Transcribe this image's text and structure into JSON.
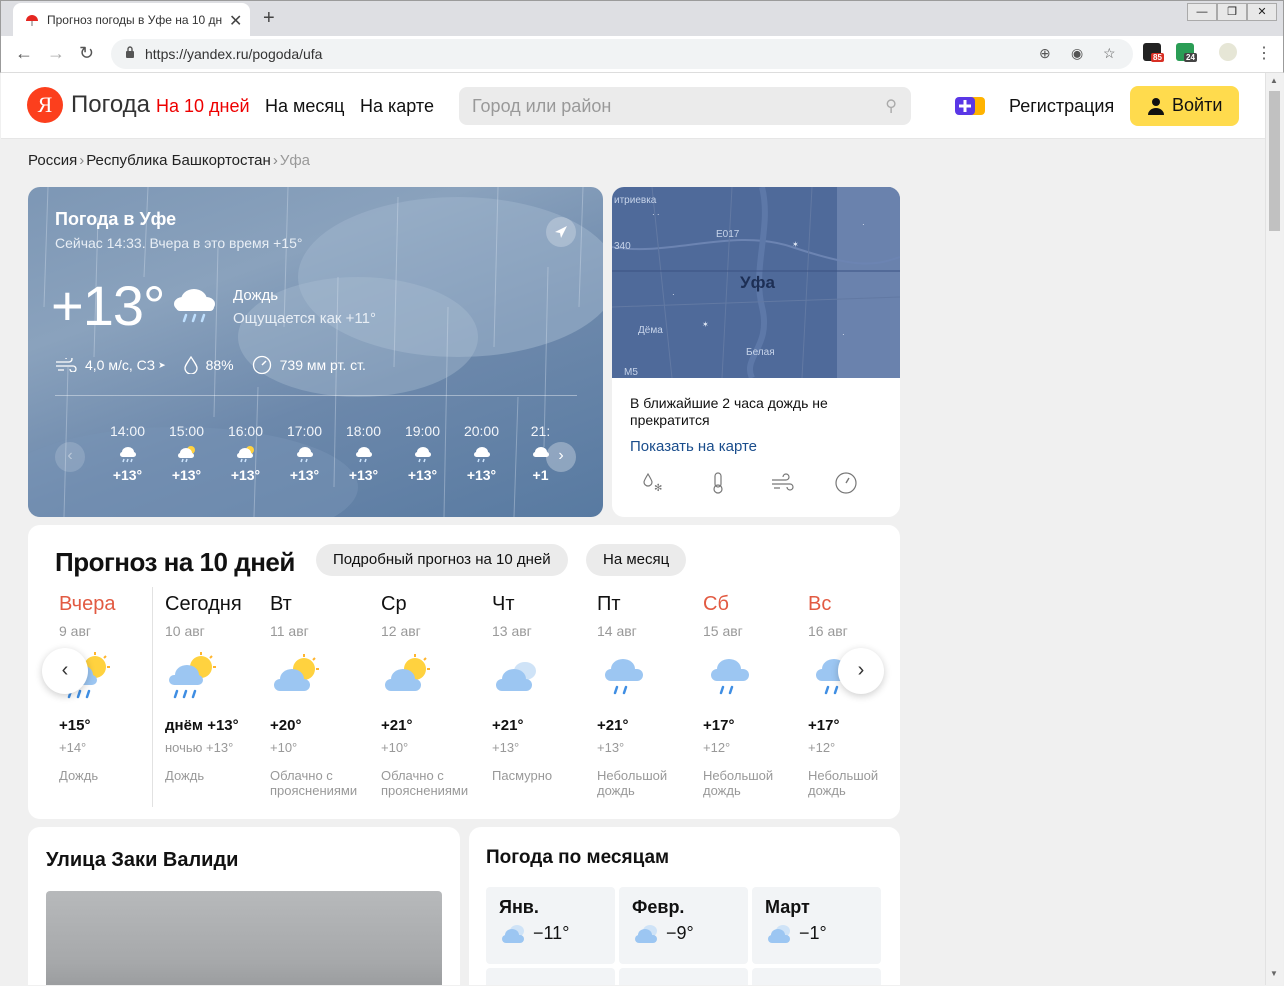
{
  "browser": {
    "tab_title": "Прогноз погоды в Уфе на 10 дн",
    "url": "https://yandex.ru/pogoda/ufa",
    "ext_badges": [
      "85",
      "24"
    ]
  },
  "header": {
    "logo_letter": "Я",
    "logo_title": "Погода",
    "nav": [
      "На 10 дней",
      "На месяц",
      "На карте"
    ],
    "search_placeholder": "Город или район",
    "register": "Регистрация",
    "login": "Войти"
  },
  "breadcrumbs": [
    "Россия",
    "Республика Башкортостан",
    "Уфа"
  ],
  "now": {
    "title": "Погода в Уфе",
    "subtitle": "Сейчас 14:33. Вчера в это время +15°",
    "temp": "+13°",
    "condition": "Дождь",
    "feels_like": "Ощущается как +11°",
    "wind": "4,0 м/с, СЗ",
    "humidity": "88%",
    "pressure": "739 мм рт. ст.",
    "hourly": [
      {
        "time": "14:00",
        "temp": "+13°",
        "icon": "rain-cloud-icon"
      },
      {
        "time": "15:00",
        "temp": "+13°",
        "icon": "sun-rain-icon"
      },
      {
        "time": "16:00",
        "temp": "+13°",
        "icon": "sun-rain-icon"
      },
      {
        "time": "17:00",
        "temp": "+13°",
        "icon": "rain-cloud-icon"
      },
      {
        "time": "18:00",
        "temp": "+13°",
        "icon": "rain-cloud-icon"
      },
      {
        "time": "19:00",
        "temp": "+13°",
        "icon": "rain-cloud-icon"
      },
      {
        "time": "20:00",
        "temp": "+13°",
        "icon": "rain-cloud-icon"
      },
      {
        "time": "21:",
        "temp": "+1",
        "icon": "rain-cloud-icon"
      }
    ]
  },
  "map": {
    "city": "Уфа",
    "labels": [
      "итриевка",
      "340",
      "Е017",
      "Дёма",
      "М5",
      "Белая"
    ],
    "nowcast": "В ближайшие 2 часа дождь не прекратится",
    "link": "Показать на карте"
  },
  "forecast": {
    "title": "Прогноз на 10 дней",
    "pill_detailed": "Подробный прогноз на 10 дней",
    "pill_month": "На месяц",
    "days": [
      {
        "name": "Вчера",
        "date": "9 авг",
        "hi": "+15°",
        "lo": "+14°",
        "cond": "Дождь",
        "weekend": true,
        "icon": "sun-rain-icon"
      },
      {
        "name": "Сегодня",
        "date": "10 авг",
        "hi": "днём +13°",
        "lo": "ночью +13°",
        "cond": "Дождь",
        "weekend": false,
        "icon": "sun-rain-icon"
      },
      {
        "name": "Вт",
        "date": "11 авг",
        "hi": "+20°",
        "lo": "+10°",
        "cond": "Облачно с прояснениями",
        "weekend": false,
        "icon": "partly-cloudy-icon"
      },
      {
        "name": "Ср",
        "date": "12 авг",
        "hi": "+21°",
        "lo": "+10°",
        "cond": "Облачно с прояснениями",
        "weekend": false,
        "icon": "partly-cloudy-icon"
      },
      {
        "name": "Чт",
        "date": "13 авг",
        "hi": "+21°",
        "lo": "+13°",
        "cond": "Пасмурно",
        "weekend": false,
        "icon": "overcast-icon"
      },
      {
        "name": "Пт",
        "date": "14 авг",
        "hi": "+21°",
        "lo": "+13°",
        "cond": "Небольшой дождь",
        "weekend": false,
        "icon": "rain-cloud-icon"
      },
      {
        "name": "Сб",
        "date": "15 авг",
        "hi": "+17°",
        "lo": "+12°",
        "cond": "Небольшой дождь",
        "weekend": true,
        "icon": "rain-cloud-icon"
      },
      {
        "name": "Вс",
        "date": "16 авг",
        "hi": "+17°",
        "lo": "+12°",
        "cond": "Небольшой дождь",
        "weekend": true,
        "icon": "rain-cloud-icon"
      }
    ]
  },
  "street": {
    "title": "Улица Заки Валиди"
  },
  "months": {
    "title": "Погода по месяцам",
    "items": [
      {
        "name": "Янв.",
        "temp": "−11°"
      },
      {
        "name": "Февр.",
        "temp": "−9°"
      },
      {
        "name": "Март",
        "temp": "−1°"
      }
    ]
  },
  "colors": {
    "accent_red": "#ee0000",
    "login_yellow": "#ffdb4d",
    "weekend_red": "#e25a42",
    "link_blue": "#1a4d8c"
  }
}
